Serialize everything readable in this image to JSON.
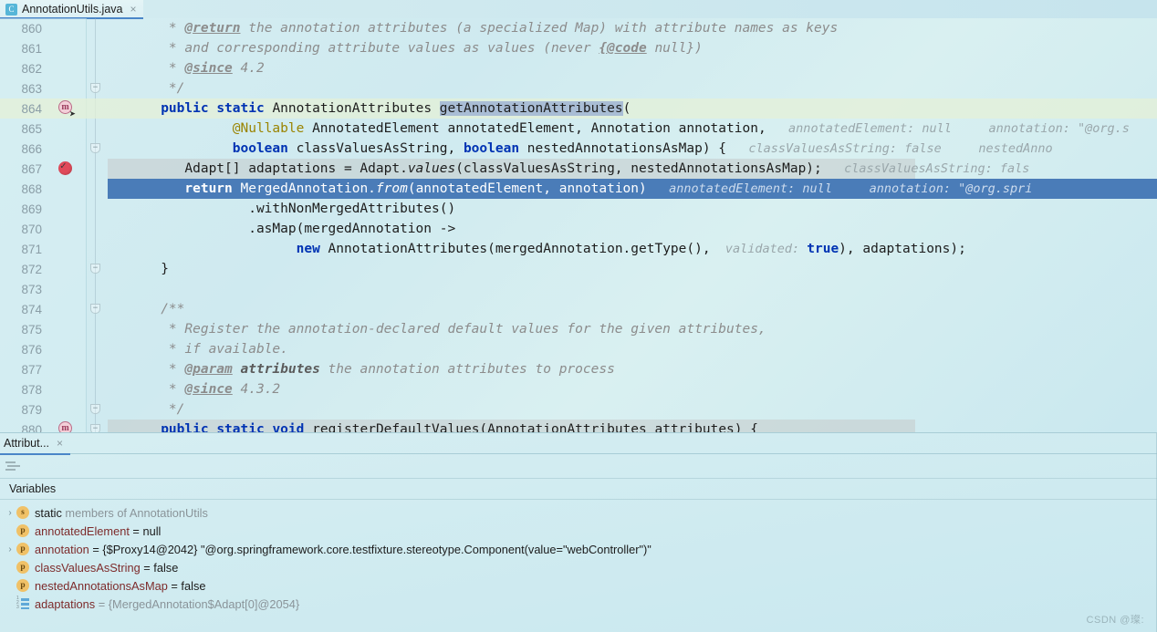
{
  "window": {
    "watermark": "CSDN @璨:"
  },
  "editor_tab": {
    "icon": "java-class-icon",
    "label": "AnnotationUtils.java",
    "close": "×"
  },
  "code": {
    "lines": [
      {
        "no": "860",
        "gutter": "",
        "fold": "",
        "hl": "none",
        "tokens": [
          {
            "t": "    * ",
            "c": "cmt"
          },
          {
            "t": "@return",
            "c": "tag"
          },
          {
            "t": " the annotation attributes (a specialized Map) with attribute names as keys",
            "c": "cmt"
          }
        ]
      },
      {
        "no": "861",
        "gutter": "",
        "fold": "",
        "hl": "none",
        "tokens": [
          {
            "t": "    * and corresponding attribute values as values (never ",
            "c": "cmt"
          },
          {
            "t": "{@code",
            "c": "tag"
          },
          {
            "t": " null})",
            "c": "cmt"
          }
        ]
      },
      {
        "no": "862",
        "gutter": "",
        "fold": "",
        "hl": "none",
        "tokens": [
          {
            "t": "    * ",
            "c": "cmt"
          },
          {
            "t": "@since",
            "c": "tag"
          },
          {
            "t": " 4.2",
            "c": "cmt"
          }
        ]
      },
      {
        "no": "863",
        "gutter": "",
        "fold": "pin",
        "hl": "none",
        "tokens": [
          {
            "t": "    */",
            "c": "cmt"
          }
        ]
      },
      {
        "no": "864",
        "gutter": "method-bulb",
        "fold": "",
        "hl": "method",
        "tokens": [
          {
            "t": "   ",
            "c": "ident"
          },
          {
            "t": "public",
            "c": "kw"
          },
          {
            "t": " ",
            "c": "ident"
          },
          {
            "t": "static",
            "c": "kw"
          },
          {
            "t": " AnnotationAttributes ",
            "c": "ident"
          },
          {
            "t": "getAnnotationAttributes",
            "c": "sel"
          },
          {
            "t": "(",
            "c": "ident"
          }
        ]
      },
      {
        "no": "865",
        "gutter": "",
        "fold": "",
        "hl": "none",
        "tokens": [
          {
            "t": "            ",
            "c": "ident"
          },
          {
            "t": "@Nullable",
            "c": "anno"
          },
          {
            "t": " AnnotatedElement annotatedElement, Annotation annotation,",
            "c": "ident"
          },
          {
            "t": "   annotatedElement: null     annotation: \"@org.s",
            "c": "hint"
          }
        ]
      },
      {
        "no": "866",
        "gutter": "",
        "fold": "pin",
        "hl": "none",
        "tokens": [
          {
            "t": "            ",
            "c": "ident"
          },
          {
            "t": "boolean",
            "c": "kw"
          },
          {
            "t": " classValuesAsString, ",
            "c": "ident"
          },
          {
            "t": "boolean",
            "c": "kw"
          },
          {
            "t": " nestedAnnotationsAsMap) {",
            "c": "ident"
          },
          {
            "t": "   classValuesAsString: false     nestedAnno",
            "c": "hint"
          }
        ]
      },
      {
        "no": "867",
        "gutter": "breakpoint",
        "fold": "",
        "hl": "gray",
        "tokens": [
          {
            "t": "      Adapt[] adaptations = Adapt.",
            "c": "ident"
          },
          {
            "t": "values",
            "c": "meth-it"
          },
          {
            "t": "(classValuesAsString, nestedAnnotationsAsMap);",
            "c": "ident"
          },
          {
            "t": "   classValuesAsString: fals",
            "c": "hint"
          }
        ]
      },
      {
        "no": "868",
        "gutter": "",
        "fold": "",
        "hl": "exec",
        "tokens": [
          {
            "t": "      ",
            "c": "ident"
          },
          {
            "t": "return",
            "c": "kw"
          },
          {
            "t": " MergedAnnotation.",
            "c": "ident"
          },
          {
            "t": "from",
            "c": "meth-it"
          },
          {
            "t": "(annotatedElement, annotation)",
            "c": "ident"
          },
          {
            "t": "   annotatedElement: null     annotation: \"@org.spri",
            "c": "hint"
          }
        ]
      },
      {
        "no": "869",
        "gutter": "",
        "fold": "",
        "hl": "none",
        "tokens": [
          {
            "t": "              .withNonMergedAttributes()",
            "c": "ident"
          }
        ]
      },
      {
        "no": "870",
        "gutter": "",
        "fold": "",
        "hl": "none",
        "tokens": [
          {
            "t": "              .asMap(mergedAnnotation ->",
            "c": "ident"
          }
        ]
      },
      {
        "no": "871",
        "gutter": "",
        "fold": "",
        "hl": "none",
        "tokens": [
          {
            "t": "                    ",
            "c": "ident"
          },
          {
            "t": "new",
            "c": "kw"
          },
          {
            "t": " AnnotationAttributes(mergedAnnotation.getType(),",
            "c": "ident"
          },
          {
            "t": "  validated: ",
            "c": "hint"
          },
          {
            "t": "true",
            "c": "kw"
          },
          {
            "t": "), adaptations);",
            "c": "ident"
          }
        ]
      },
      {
        "no": "872",
        "gutter": "",
        "fold": "pin",
        "hl": "none",
        "tokens": [
          {
            "t": "   }",
            "c": "ident"
          }
        ]
      },
      {
        "no": "873",
        "gutter": "",
        "fold": "",
        "hl": "none",
        "tokens": [
          {
            "t": "",
            "c": "ident"
          }
        ]
      },
      {
        "no": "874",
        "gutter": "",
        "fold": "pin",
        "hl": "none",
        "tokens": [
          {
            "t": "   /**",
            "c": "cmt"
          }
        ]
      },
      {
        "no": "875",
        "gutter": "",
        "fold": "",
        "hl": "none",
        "tokens": [
          {
            "t": "    * Register the annotation-declared default values for the given attributes,",
            "c": "cmt"
          }
        ]
      },
      {
        "no": "876",
        "gutter": "",
        "fold": "",
        "hl": "none",
        "tokens": [
          {
            "t": "    * if available.",
            "c": "cmt"
          }
        ]
      },
      {
        "no": "877",
        "gutter": "",
        "fold": "",
        "hl": "none",
        "tokens": [
          {
            "t": "    * ",
            "c": "cmt"
          },
          {
            "t": "@param",
            "c": "tag"
          },
          {
            "t": " attributes",
            "c": "tagb"
          },
          {
            "t": " the annotation attributes to process",
            "c": "cmt"
          }
        ]
      },
      {
        "no": "878",
        "gutter": "",
        "fold": "",
        "hl": "none",
        "tokens": [
          {
            "t": "    * ",
            "c": "cmt"
          },
          {
            "t": "@since",
            "c": "tag"
          },
          {
            "t": " 4.3.2",
            "c": "cmt"
          }
        ]
      },
      {
        "no": "879",
        "gutter": "",
        "fold": "pin",
        "hl": "none",
        "tokens": [
          {
            "t": "    */",
            "c": "cmt"
          }
        ]
      },
      {
        "no": "880",
        "gutter": "method",
        "fold": "pin",
        "hl": "gray",
        "tokens": [
          {
            "t": "   ",
            "c": "ident"
          },
          {
            "t": "public",
            "c": "kw"
          },
          {
            "t": " ",
            "c": "ident"
          },
          {
            "t": "static",
            "c": "kw"
          },
          {
            "t": " ",
            "c": "ident"
          },
          {
            "t": "void",
            "c": "kw"
          },
          {
            "t": " registerDefaultValues(AnnotationAttributes attributes) {",
            "c": "ident"
          }
        ]
      }
    ]
  },
  "debug": {
    "tab_label": "Attribut...",
    "tab_close": "×",
    "toolbar_icon": "layout-settings-icon",
    "variables_header": "Variables",
    "rows": [
      {
        "chevron": "›",
        "icon": "s",
        "icon_kind": "static",
        "name": "static",
        "rest": " members of AnnotationUtils",
        "name_class": "vval",
        "rest_class": "vgray"
      },
      {
        "chevron": "",
        "icon": "p",
        "icon_kind": "param",
        "name": "annotatedElement",
        "rest": " = null",
        "name_class": "vname",
        "rest_class": "vval"
      },
      {
        "chevron": "›",
        "icon": "p",
        "icon_kind": "param",
        "name": "annotation",
        "rest": " = {$Proxy14@2042} \"@org.springframework.core.testfixture.stereotype.Component(value=\"webController\")\"",
        "name_class": "vname",
        "rest_class": "vval"
      },
      {
        "chevron": "",
        "icon": "p",
        "icon_kind": "param",
        "name": "classValuesAsString",
        "rest": " = false",
        "name_class": "vname",
        "rest_class": "vval"
      },
      {
        "chevron": "",
        "icon": "p",
        "icon_kind": "param",
        "name": "nestedAnnotationsAsMap",
        "rest": " = false",
        "name_class": "vname",
        "rest_class": "vval"
      },
      {
        "chevron": "",
        "icon": "array",
        "icon_kind": "array",
        "name": "adaptations",
        "rest": " = {MergedAnnotation$Adapt[0]@2054}",
        "name_class": "vname",
        "rest_class": "vgray"
      }
    ]
  }
}
